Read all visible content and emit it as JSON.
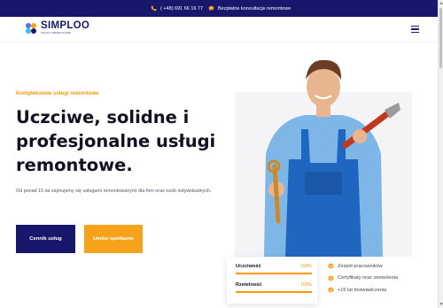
{
  "topbar": {
    "phone": "( +48) 691 66 16 77",
    "consultation": "Bezpłatne konsultacje remontowe"
  },
  "brand": {
    "name": "SIMPLOO",
    "tagline": "USŁUGI REMONTOWE"
  },
  "hero": {
    "eyebrow": "Kompleksowe usługi remontowe",
    "headline": "Uczciwe, solidne i profesjonalne usługi remontowe.",
    "description": "Od ponad 15 lat zajmujemy się usługami remontowanymi dla firm oraz osób indywidualnych.",
    "buttons": {
      "primary": "Cennik usług",
      "secondary": "Umów spotkanie"
    }
  },
  "metrics": [
    {
      "label": "Uczciwość",
      "value": "100%",
      "fraction": 1.0
    },
    {
      "label": "Rzetelność",
      "value": "100%",
      "fraction": 1.0
    }
  ],
  "features": [
    "Zespół pracowników",
    "Certyfikaty oraz zezwolenia",
    "+15 lat doświadczenia"
  ],
  "colors": {
    "navy": "#17176b",
    "orange": "#f7a21b",
    "heading": "#111122"
  },
  "icons": {
    "phone": "phone-icon",
    "chat": "chat-icon",
    "menu": "hamburger-menu-icon",
    "check": "check-badge-icon"
  }
}
